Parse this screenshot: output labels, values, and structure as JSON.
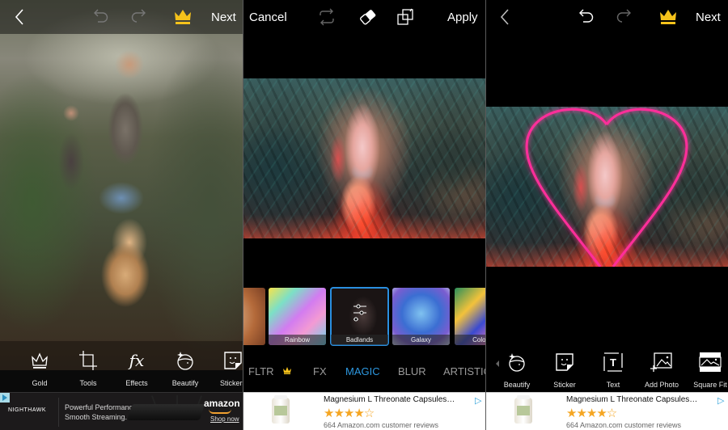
{
  "panels": {
    "left": {
      "header": {
        "back_icon": "chevron-left-icon",
        "undo_icon": "undo-icon",
        "redo_icon": "redo-icon",
        "premium_icon": "crown-icon",
        "next_label": "Next"
      },
      "toolbar": [
        {
          "label": "Gold",
          "icon": "crown-outline-icon"
        },
        {
          "label": "Tools",
          "icon": "crop-icon"
        },
        {
          "label": "Effects",
          "icon": "fx-icon"
        },
        {
          "label": "Beautify",
          "icon": "face-sparkle-icon"
        },
        {
          "label": "Stickers",
          "icon": "sticker-icon"
        }
      ],
      "ad": {
        "brand": "NIGHTHAWK",
        "line1": "Powerful Performance.",
        "line2": "Smooth Streaming.",
        "advertiser": "amazon",
        "cta": "Shop now"
      }
    },
    "middle": {
      "header": {
        "cancel_label": "Cancel",
        "swap_icon": "swap-icon",
        "eraser_icon": "eraser-icon",
        "blend_icon": "blend-layers-icon",
        "apply_label": "Apply"
      },
      "effects": [
        {
          "label": "",
          "selected": false
        },
        {
          "label": "Rainbow",
          "selected": false
        },
        {
          "label": "Badlands",
          "selected": true
        },
        {
          "label": "Galaxy",
          "selected": false
        },
        {
          "label": "Color S",
          "selected": false
        }
      ],
      "categories": [
        {
          "label": "FLTR",
          "active": false,
          "premium": true
        },
        {
          "label": "FX",
          "active": false,
          "premium": false
        },
        {
          "label": "MAGIC",
          "active": true,
          "premium": false
        },
        {
          "label": "BLUR",
          "active": false,
          "premium": false
        },
        {
          "label": "ARTISTIC",
          "active": false,
          "premium": false
        }
      ],
      "ad": {
        "title": "Magnesium L Threonate Capsules…",
        "rating": 4.5,
        "stars_text": "★★★★☆",
        "reviews": "664 Amazon.com customer reviews"
      }
    },
    "right": {
      "header": {
        "back_icon": "chevron-left-icon",
        "undo_icon": "undo-icon",
        "redo_icon": "redo-icon",
        "premium_icon": "crown-icon",
        "next_label": "Next"
      },
      "toolbar": [
        {
          "label": "Beautify",
          "icon": "face-sparkle-icon"
        },
        {
          "label": "Sticker",
          "icon": "sticker-icon"
        },
        {
          "label": "Text",
          "icon": "text-icon"
        },
        {
          "label": "Add Photo",
          "icon": "add-photo-icon"
        },
        {
          "label": "Square Fit",
          "icon": "square-fit-icon"
        }
      ],
      "ad": {
        "title": "Magnesium L Threonate Capsules…",
        "rating": 4.5,
        "stars_text": "★★★★☆",
        "reviews": "664 Amazon.com customer reviews"
      }
    }
  },
  "colors": {
    "accent": "#2d98e0",
    "gold": "#f5c21b",
    "neon": "#ff2f9a",
    "star": "#f5a623"
  }
}
